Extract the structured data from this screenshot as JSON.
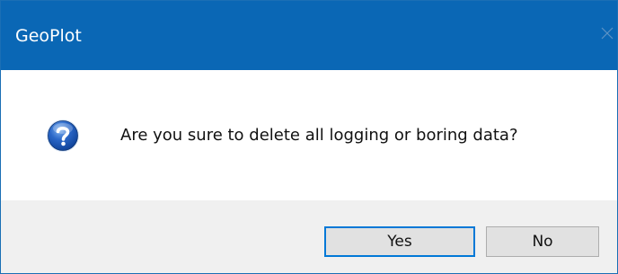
{
  "window": {
    "title": "GeoPlot",
    "close_icon": "close-icon",
    "title_bar_color": "#0a67b5"
  },
  "message": {
    "icon": "question-icon",
    "text": "Are you sure to delete all logging or boring data?"
  },
  "buttons": {
    "yes_label": "Yes",
    "no_label": "No"
  }
}
